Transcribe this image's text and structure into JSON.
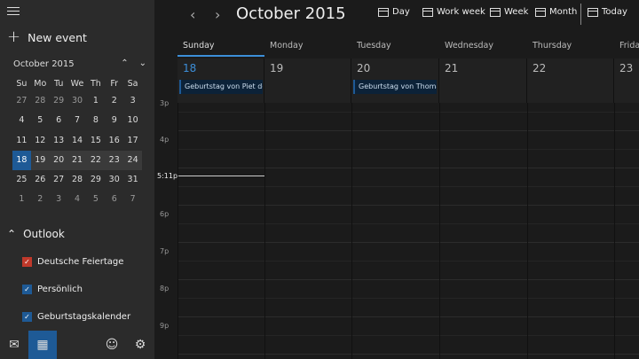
{
  "sidebar": {
    "new_event": "New event",
    "mini_month": "October 2015",
    "dow": [
      "Su",
      "Mo",
      "Tu",
      "We",
      "Th",
      "Fr",
      "Sa"
    ],
    "weeks": [
      [
        "27",
        "28",
        "29",
        "30",
        "1",
        "2",
        "3"
      ],
      [
        "4",
        "5",
        "6",
        "7",
        "8",
        "9",
        "10"
      ],
      [
        "11",
        "12",
        "13",
        "14",
        "15",
        "16",
        "17"
      ],
      [
        "18",
        "19",
        "20",
        "21",
        "22",
        "23",
        "24"
      ],
      [
        "25",
        "26",
        "27",
        "28",
        "29",
        "30",
        "31"
      ],
      [
        "1",
        "2",
        "3",
        "4",
        "5",
        "6",
        "7"
      ]
    ],
    "group": "Outlook",
    "calendars": [
      {
        "label": "Deutsche Feiertage",
        "color": "#c0392b"
      },
      {
        "label": "Persönlich",
        "color": "#1e5a96"
      },
      {
        "label": "Geburtstagskalender",
        "color": "#1e5a96"
      }
    ]
  },
  "header": {
    "title": "October 2015",
    "views": {
      "day": "Day",
      "work_week": "Work week",
      "week": "Week",
      "month": "Month",
      "today": "Today"
    }
  },
  "days": [
    {
      "name": "Sunday",
      "num": "18"
    },
    {
      "name": "Monday",
      "num": "19"
    },
    {
      "name": "Tuesday",
      "num": "20"
    },
    {
      "name": "Wednesday",
      "num": "21"
    },
    {
      "name": "Thursday",
      "num": "22"
    },
    {
      "name": "Frida",
      "num": "23"
    }
  ],
  "events": [
    {
      "text": "Geburtstag von Piet de"
    },
    {
      "text": "Geburtstag von Thoma:"
    }
  ],
  "hours": {
    "top": "3p",
    "h4": "4p",
    "h6": "6p",
    "h7": "7p",
    "h8": "8p",
    "h9": "9p"
  },
  "now_label": "5:11p",
  "colors": {
    "accent": "#1e5a96",
    "today_text": "#3c8ed8"
  }
}
